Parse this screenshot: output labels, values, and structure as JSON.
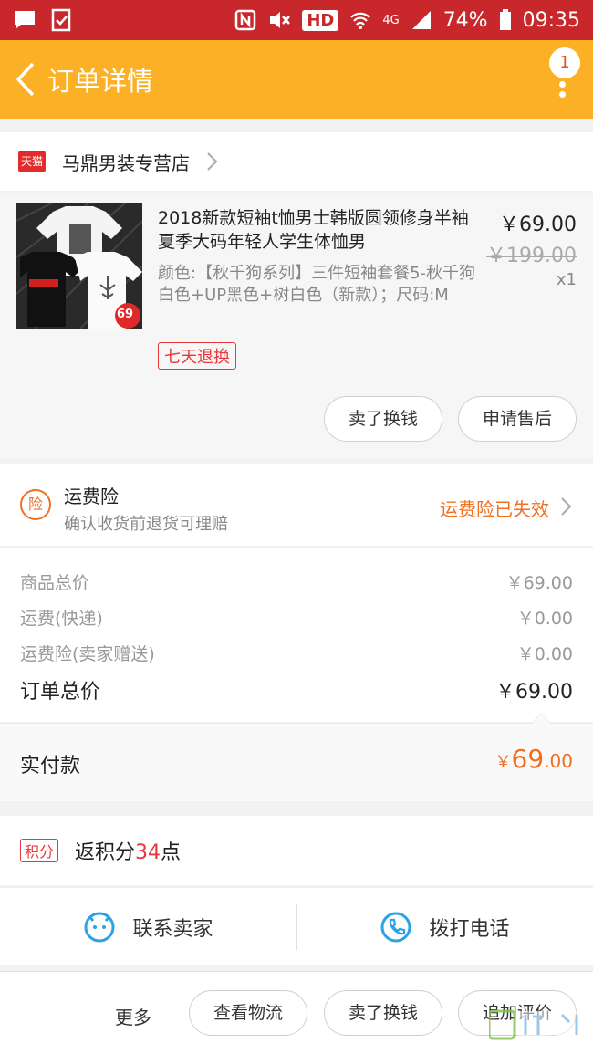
{
  "status_bar": {
    "battery": "74%",
    "time": "09:35",
    "network": "4G",
    "hd": "HD"
  },
  "nav": {
    "title": "订单详情",
    "badge_count": "1"
  },
  "shop": {
    "badge": "天猫",
    "name": "马鼎男装专营店"
  },
  "item": {
    "title": "2018新款短袖t恤男士韩版圆领修身半袖夏季大码年轻人学生体恤男",
    "spec": "颜色:【秋千狗系列】三件短袖套餐5-秋千狗白色+UP黑色+树白色（新款）；尺码:M",
    "tag": "七天退换",
    "price": "￥69.00",
    "original_price": "￥199.00",
    "quantity": "x1",
    "thumb_text": "69",
    "buttons": [
      "卖了换钱",
      "申请售后"
    ]
  },
  "insurance": {
    "icon_text": "险",
    "title": "运费险",
    "subtitle": "确认收货前退货可理赔",
    "status": "运费险已失效"
  },
  "fees": [
    {
      "label": "商品总价",
      "value": "￥69.00"
    },
    {
      "label": "运费(快递)",
      "value": "￥0.00"
    },
    {
      "label": "运费险(卖家赠送)",
      "value": "￥0.00"
    }
  ],
  "total": {
    "label": "订单总价",
    "value": "￥69.00"
  },
  "paid": {
    "label": "实付款",
    "currency": "￥",
    "integer": "69",
    "decimal": ".00"
  },
  "points": {
    "tag": "积分",
    "prefix": "返积分",
    "count": "34",
    "suffix": "点"
  },
  "contact": {
    "seller": "联系卖家",
    "call": "拨打电话"
  },
  "footer": {
    "more": "更多",
    "buttons": [
      "查看物流",
      "卖了换钱",
      "追加评价"
    ]
  },
  "colors": {
    "status_bar": "#c8282b",
    "nav": "#fbb026",
    "accent": "#f07020",
    "red": "#e8383b",
    "blue": "#2aa3e6"
  }
}
